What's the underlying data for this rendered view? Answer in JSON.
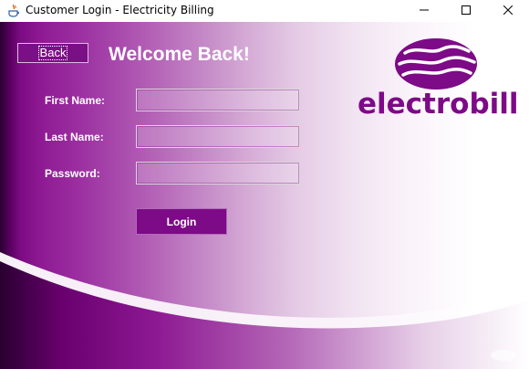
{
  "window": {
    "title": "Customer Login - Electricity Billing",
    "icon": "java-cup-icon",
    "controls": [
      "minimize-icon",
      "maximize-icon",
      "close-icon"
    ]
  },
  "header": {
    "back_label": "Back",
    "welcome": "Welcome Back!"
  },
  "form": {
    "first_name_label": "First Name:",
    "first_name_value": "",
    "last_name_label": "Last Name:",
    "last_name_value": "",
    "password_label": "Password:",
    "password_value": "",
    "login_label": "Login"
  },
  "logo": {
    "text": "electrobill"
  },
  "colors": {
    "accent": "#7d0a86",
    "logo": "#7d0a86"
  }
}
